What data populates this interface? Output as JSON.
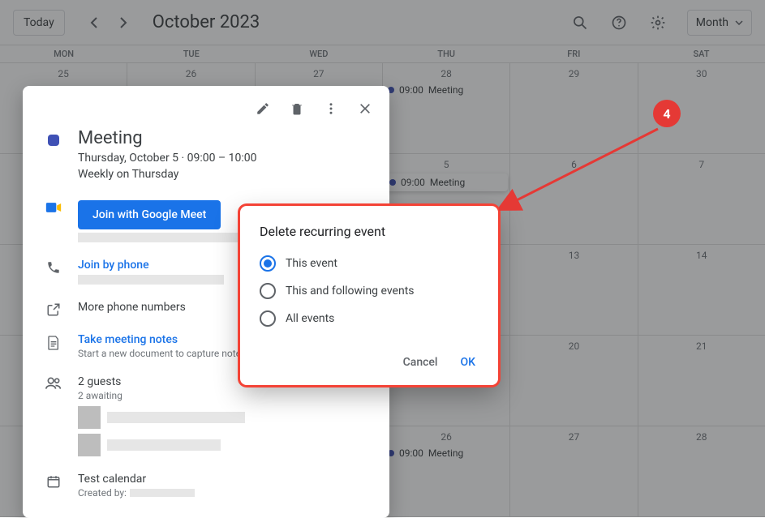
{
  "header": {
    "today": "Today",
    "title": "October 2023",
    "view": "Month"
  },
  "dayNames": [
    "MON",
    "TUE",
    "WED",
    "THU",
    "FRI",
    "SAT"
  ],
  "weeks": [
    {
      "days": [
        {
          "n": "25"
        },
        {
          "n": "26"
        },
        {
          "n": "27"
        },
        {
          "n": "28",
          "evt": {
            "time": "09:00",
            "label": "Meeting"
          }
        },
        {
          "n": "29"
        },
        {
          "n": "30"
        }
      ]
    },
    {
      "days": [
        {
          "n": ""
        },
        {
          "n": ""
        },
        {
          "n": ""
        },
        {
          "n": "5",
          "evt": {
            "time": "09:00",
            "label": "Meeting",
            "shadow": true
          }
        },
        {
          "n": "6"
        },
        {
          "n": "7"
        }
      ]
    },
    {
      "days": [
        {
          "n": ""
        },
        {
          "n": ""
        },
        {
          "n": ""
        },
        {
          "n": ""
        },
        {
          "n": "13"
        },
        {
          "n": "14"
        }
      ]
    },
    {
      "days": [
        {
          "n": ""
        },
        {
          "n": ""
        },
        {
          "n": ""
        },
        {
          "n": ""
        },
        {
          "n": "20"
        },
        {
          "n": "21"
        }
      ]
    },
    {
      "days": [
        {
          "n": ""
        },
        {
          "n": ""
        },
        {
          "n": ""
        },
        {
          "n": "26",
          "evt": {
            "time": "09:00",
            "label": "Meeting"
          }
        },
        {
          "n": "27"
        },
        {
          "n": "28"
        }
      ]
    }
  ],
  "event": {
    "title": "Meeting",
    "datetime": "Thursday, October 5  ·  09:00 – 10:00",
    "recurrence": "Weekly on Thursday",
    "joinMeet": "Join with Google Meet",
    "joinPhone": "Join by phone",
    "morePhone": "More phone numbers",
    "notesLink": "Take meeting notes",
    "notesSub": "Start a new document to capture notes",
    "guestsCount": "2 guests",
    "guestsSub": "2 awaiting",
    "calendarName": "Test calendar",
    "createdBy": "Created by:"
  },
  "modal": {
    "title": "Delete recurring event",
    "opt1": "This event",
    "opt2": "This and following events",
    "opt3": "All events",
    "cancel": "Cancel",
    "ok": "OK"
  },
  "annotation": {
    "step": "4"
  }
}
